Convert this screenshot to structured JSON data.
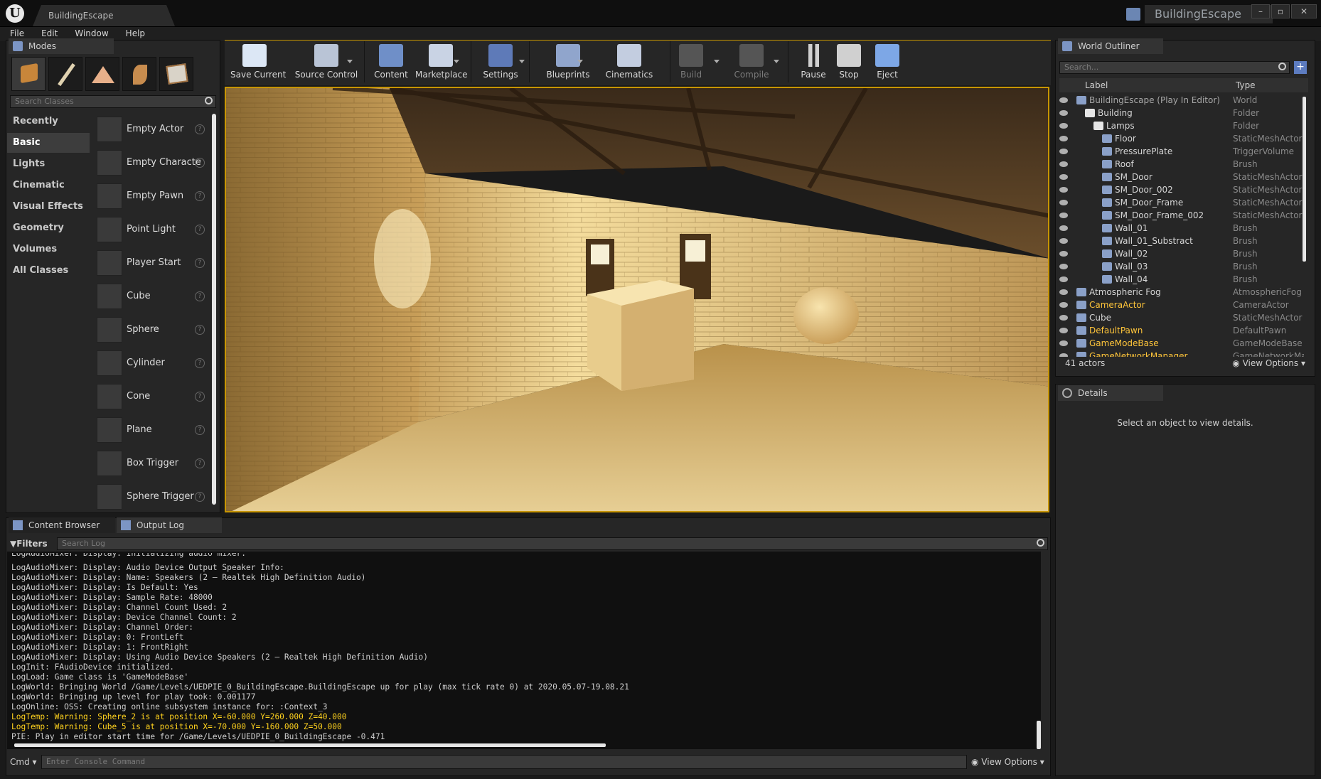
{
  "app": {
    "tab_title": "BuildingEscape",
    "project_name": "BuildingEscape",
    "logo": "U"
  },
  "menu": [
    "File",
    "Edit",
    "Window",
    "Help"
  ],
  "modes": {
    "tab": "Modes",
    "tools": [
      "place-icon",
      "paint-icon",
      "landscape-icon",
      "foliage-icon",
      "geometry-edit-icon"
    ],
    "search_placeholder": "Search Classes",
    "categories": [
      "Recently Placed",
      "Basic",
      "Lights",
      "Cinematic",
      "Visual Effects",
      "Geometry",
      "Volumes",
      "All Classes"
    ],
    "selected_category": "Basic",
    "items": [
      "Empty Actor",
      "Empty Characte",
      "Empty Pawn",
      "Point Light",
      "Player Start",
      "Cube",
      "Sphere",
      "Cylinder",
      "Cone",
      "Plane",
      "Box Trigger",
      "Sphere Trigger"
    ],
    "help_glyph": "?"
  },
  "toolbar": {
    "buttons": [
      {
        "label": "Save Current",
        "icon": "save-icon"
      },
      {
        "label": "Source Control",
        "icon": "source-control-icon"
      },
      {
        "label": "Content",
        "icon": "content-icon"
      },
      {
        "label": "Marketplace",
        "icon": "marketplace-icon"
      },
      {
        "label": "Settings",
        "icon": "settings-icon"
      },
      {
        "label": "Blueprints",
        "icon": "blueprints-icon"
      },
      {
        "label": "Cinematics",
        "icon": "cinematics-icon"
      },
      {
        "label": "Build",
        "icon": "build-icon"
      },
      {
        "label": "Compile",
        "icon": "compile-icon"
      },
      {
        "label": "Pause",
        "icon": "pause-icon"
      },
      {
        "label": "Stop",
        "icon": "stop-icon"
      },
      {
        "label": "Eject",
        "icon": "eject-icon"
      }
    ]
  },
  "outliner": {
    "tab": "World Outliner",
    "search_placeholder": "Search...",
    "col_label": "Label",
    "col_type": "Type",
    "rows": [
      {
        "label": "BuildingEscape (Play In Editor)",
        "type": "World"
      },
      {
        "label": "Building",
        "type": "Folder"
      },
      {
        "label": "Lamps",
        "type": "Folder"
      },
      {
        "label": "Floor",
        "type": "StaticMeshActor"
      },
      {
        "label": "PressurePlate",
        "type": "TriggerVolume"
      },
      {
        "label": "Roof",
        "type": "Brush"
      },
      {
        "label": "SM_Door",
        "type": "StaticMeshActor"
      },
      {
        "label": "SM_Door_002",
        "type": "StaticMeshActor"
      },
      {
        "label": "SM_Door_Frame",
        "type": "StaticMeshActor"
      },
      {
        "label": "SM_Door_Frame_002",
        "type": "StaticMeshActor"
      },
      {
        "label": "Wall_01",
        "type": "Brush"
      },
      {
        "label": "Wall_01_Substract",
        "type": "Brush"
      },
      {
        "label": "Wall_02",
        "type": "Brush"
      },
      {
        "label": "Wall_03",
        "type": "Brush"
      },
      {
        "label": "Wall_04",
        "type": "Brush"
      },
      {
        "label": "Atmospheric Fog",
        "type": "AtmosphericFog"
      },
      {
        "label": "CameraActor",
        "type": "CameraActor"
      },
      {
        "label": "Cube",
        "type": "StaticMeshActor"
      },
      {
        "label": "DefaultPawn",
        "type": "DefaultPawn"
      },
      {
        "label": "GameModeBase",
        "type": "GameModeBase"
      },
      {
        "label": "GameNetworkManager",
        "type": "GameNetworkMa"
      }
    ],
    "actor_count": "41 actors",
    "view_options": "View Options"
  },
  "details": {
    "tab": "Details",
    "empty_text": "Select an object to view details."
  },
  "bottom": {
    "tabs": [
      "Content Browser",
      "Output Log"
    ],
    "filters": "Filters",
    "search_log_placeholder": "Search Log",
    "cmd_label": "Cmd",
    "console_placeholder": "Enter Console Command",
    "view_options": "View Options"
  },
  "log": [
    {
      "text": "LogAudioMixer: Display: Initializing audio mixer.",
      "warn": false
    },
    {
      "text": "LogAudioMixer: Display: Audio Device Output Speaker Info:",
      "warn": false
    },
    {
      "text": "LogAudioMixer: Display: Name: Speakers (2 — Realtek High Definition Audio)",
      "warn": false
    },
    {
      "text": "LogAudioMixer: Display: Is Default: Yes",
      "warn": false
    },
    {
      "text": "LogAudioMixer: Display: Sample Rate: 48000",
      "warn": false
    },
    {
      "text": "LogAudioMixer: Display: Channel Count Used: 2",
      "warn": false
    },
    {
      "text": "LogAudioMixer: Display: Device Channel Count: 2",
      "warn": false
    },
    {
      "text": "LogAudioMixer: Display: Channel Order:",
      "warn": false
    },
    {
      "text": "LogAudioMixer: Display: 0: FrontLeft",
      "warn": false
    },
    {
      "text": "LogAudioMixer: Display: 1: FrontRight",
      "warn": false
    },
    {
      "text": "LogAudioMixer: Display: Using Audio Device Speakers (2 — Realtek High Definition Audio)",
      "warn": false
    },
    {
      "text": "LogInit: FAudioDevice initialized.",
      "warn": false
    },
    {
      "text": "LogLoad: Game class is 'GameModeBase'",
      "warn": false
    },
    {
      "text": "LogWorld: Bringing World /Game/Levels/UEDPIE_0_BuildingEscape.BuildingEscape up for play (max tick rate 0) at 2020.05.07-19.08.21",
      "warn": false
    },
    {
      "text": "LogWorld: Bringing up level for play took: 0.001177",
      "warn": false
    },
    {
      "text": "LogOnline: OSS: Creating online subsystem instance for: :Context_3",
      "warn": false
    },
    {
      "text": "LogTemp: Warning: Sphere_2 is at position X=-60.000 Y=260.000 Z=40.000",
      "warn": true
    },
    {
      "text": "LogTemp: Warning: Cube_5 is at position X=-70.000 Y=-160.000 Z=50.000",
      "warn": true
    },
    {
      "text": "PIE: Play in editor start time for /Game/Levels/UEDPIE_0_BuildingEscape -0.471",
      "warn": false
    }
  ],
  "colors": {
    "viewport_border": "#c79500",
    "warn_text": "#ffd21e",
    "orange_label": "#ffc53a"
  }
}
